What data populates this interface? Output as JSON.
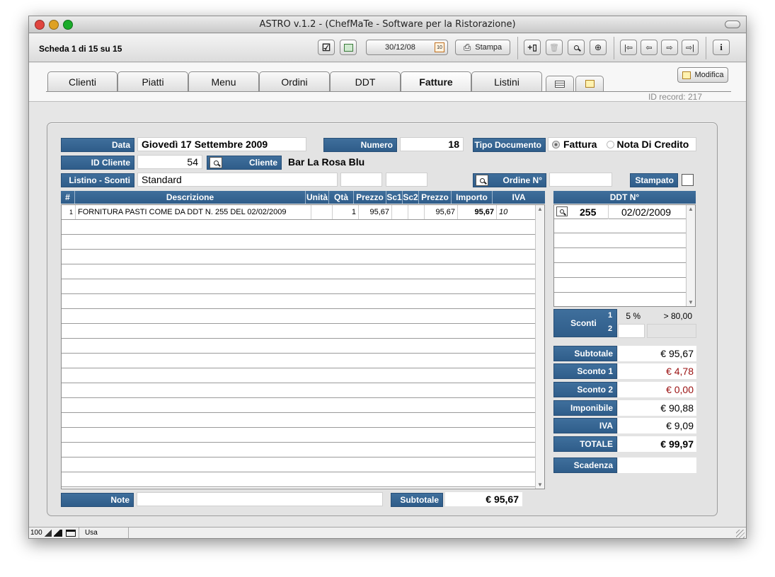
{
  "window": {
    "title": "ASTRO  v.1.2 - (ChefMaTe - Software per la Ristorazione)"
  },
  "toolbar": {
    "record_info": "Scheda 1 di 15 su 15",
    "date": "30/12/08",
    "stampa_label": "Stampa",
    "info_label": "i"
  },
  "tabs": [
    {
      "label": "Clienti"
    },
    {
      "label": "Piatti"
    },
    {
      "label": "Menu"
    },
    {
      "label": "Ordini"
    },
    {
      "label": "DDT"
    },
    {
      "label": "Fatture"
    },
    {
      "label": "Listini"
    }
  ],
  "active_tab": "Fatture",
  "modifica_label": "Modifica",
  "id_record": "ID record: 217",
  "form": {
    "data_label": "Data",
    "data_value": "Giovedì 17 Settembre 2009",
    "numero_label": "Numero",
    "numero_value": "18",
    "tipo_label": "Tipo Documento",
    "tipo_opt1": "Fattura",
    "tipo_opt2": "Nota Di Credito",
    "idcliente_label": "ID Cliente",
    "idcliente_value": "54",
    "cliente_label": "Cliente",
    "cliente_value": "Bar La Rosa Blu",
    "listino_label": "Listino - Sconti",
    "listino_value": "Standard",
    "ordine_label": "Ordine N°",
    "stampato_label": "Stampato",
    "note_label": "Note",
    "subtotale_label": "Subtotale",
    "subtotale_value": "€ 95,67"
  },
  "grid": {
    "headers": [
      "#",
      "Descrizione",
      "Unità",
      "Qtà",
      "Prezzo",
      "Sc1",
      "Sc2",
      "Prezzo",
      "Importo",
      "IVA"
    ],
    "rows": [
      {
        "n": "1",
        "descr": "FORNITURA PASTI COME DA DDT N. 255 DEL 02/02/2009",
        "unita": "",
        "qta": "1",
        "prezzo": "95,67",
        "sc1": "",
        "sc2": "",
        "prezzo_netto": "95,67",
        "importo": "95,67",
        "iva": "10"
      }
    ]
  },
  "ddt": {
    "header": "DDT N°",
    "rows": [
      {
        "numero": "255",
        "data": "02/02/2009"
      }
    ]
  },
  "sconti": {
    "label": "Sconti",
    "row1_n": "1",
    "row1_pct": "5 %",
    "row1_cond": "> 80,00",
    "row2_n": "2"
  },
  "totals": [
    {
      "label": "Subtotale",
      "value": "€ 95,67",
      "color": "#000000",
      "bold": false
    },
    {
      "label": "Sconto 1",
      "value": "€ 4,78",
      "color": "#9a1010",
      "bold": false
    },
    {
      "label": "Sconto 2",
      "value": "€ 0,00",
      "color": "#9a1010",
      "bold": false
    },
    {
      "label": "Imponibile",
      "value": "€ 90,88",
      "color": "#000000",
      "bold": false
    },
    {
      "label": "IVA",
      "value": "€ 9,09",
      "color": "#000000",
      "bold": false
    },
    {
      "label": "TOTALE",
      "value": "€ 99,97",
      "color": "#000000",
      "bold": true
    }
  ],
  "scadenza_label": "Scadenza",
  "statusbar": {
    "zoom": "100",
    "mode": "Usa"
  },
  "colors": {
    "label_bg": "#2f5d8a",
    "negative": "#9a1010"
  }
}
